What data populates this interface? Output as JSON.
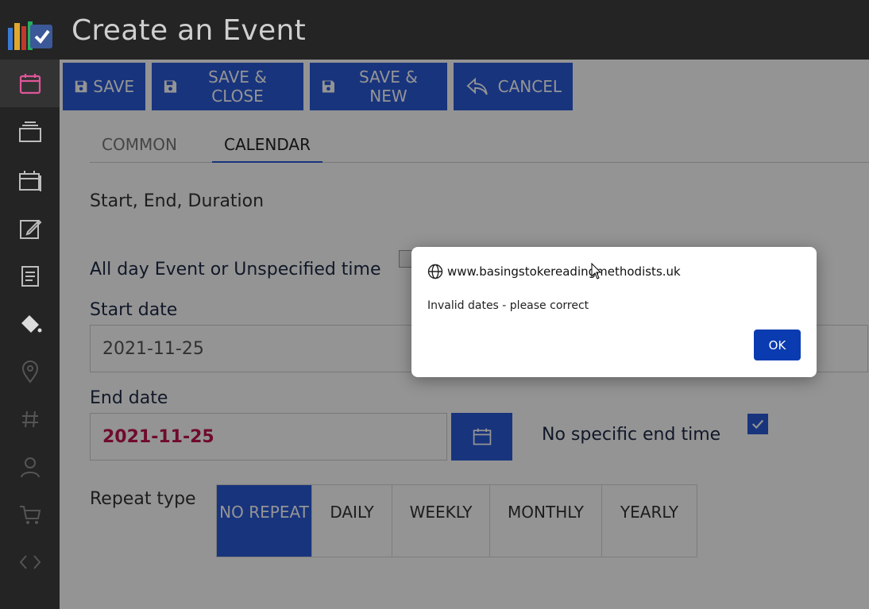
{
  "header": {
    "title": "Create an Event"
  },
  "sidebar": {
    "items": [
      {
        "icon": "calendar-icon",
        "active": true
      },
      {
        "icon": "layers-icon"
      },
      {
        "icon": "calendars-icon"
      },
      {
        "icon": "edit-icon"
      },
      {
        "icon": "document-icon"
      },
      {
        "icon": "paint-bucket-icon"
      },
      {
        "icon": "location-pin-icon"
      },
      {
        "icon": "hashtag-icon"
      },
      {
        "icon": "user-icon"
      },
      {
        "icon": "cart-icon"
      },
      {
        "icon": "code-icon"
      },
      {
        "icon": "bone-icon"
      }
    ]
  },
  "toolbar": {
    "save_label": "SAVE",
    "save_close_label": "SAVE & CLOSE",
    "save_new_label": "SAVE & NEW",
    "cancel_label": "CANCEL"
  },
  "tabs": [
    {
      "label": "COMMON",
      "active": false
    },
    {
      "label": "CALENDAR",
      "active": true
    }
  ],
  "form": {
    "section_title": "Start, End, Duration",
    "all_day_label": "All day Event or Unspecified time",
    "start_date_label": "Start date",
    "start_date_value": "2021-11-25",
    "end_date_label": "End date",
    "end_date_value": "2021-11-25",
    "no_end_time_label": "No specific end time",
    "no_end_time_checked": true,
    "repeat_type_label": "Repeat type",
    "repeat_options": [
      {
        "label": "NO REPEAT",
        "active": true
      },
      {
        "label": "DAILY",
        "active": false
      },
      {
        "label": "WEEKLY",
        "active": false
      },
      {
        "label": "MONTHLY",
        "active": false
      },
      {
        "label": "YEARLY",
        "active": false
      }
    ]
  },
  "dialog": {
    "origin": "www.basingstokereadingmethodists.uk",
    "message": "Invalid dates - please correct",
    "ok_label": "OK"
  },
  "colors": {
    "primary": "#2a5bd7",
    "header_bg": "#242424",
    "invalid_text": "#c0144b",
    "dialog_button": "#0a3bb0"
  }
}
